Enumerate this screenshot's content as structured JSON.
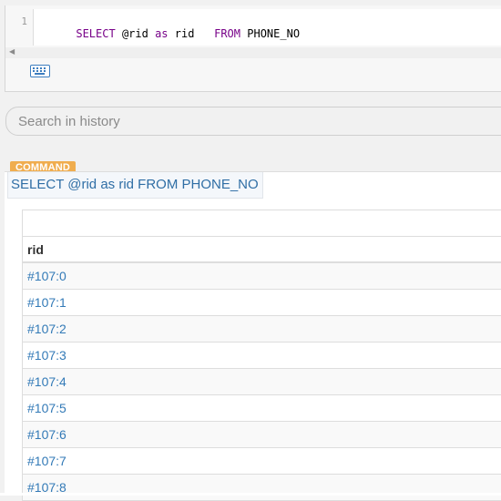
{
  "editor": {
    "line_number": "1",
    "tokens": [
      {
        "text": "SELECT",
        "kind": "kw"
      },
      {
        "text": " @rid ",
        "kind": "plain"
      },
      {
        "text": "as",
        "kind": "kw"
      },
      {
        "text": " rid   ",
        "kind": "plain"
      },
      {
        "text": "FROM",
        "kind": "kw"
      },
      {
        "text": " PHONE_NO",
        "kind": "plain"
      }
    ],
    "keyboard_icon": "keyboard-icon"
  },
  "search": {
    "placeholder": "Search in history"
  },
  "history": {
    "badge": "COMMAND",
    "command": "SELECT @rid as rid FROM PHONE_NO",
    "table": {
      "header": "rid",
      "rows": [
        "#107:0",
        "#107:1",
        "#107:2",
        "#107:3",
        "#107:4",
        "#107:5",
        "#107:6",
        "#107:7",
        "#107:8"
      ]
    }
  },
  "colors": {
    "keyword": "#770088",
    "badge": "#f0ad4e",
    "link": "#337ab7",
    "command_text": "#2f6ea5"
  }
}
